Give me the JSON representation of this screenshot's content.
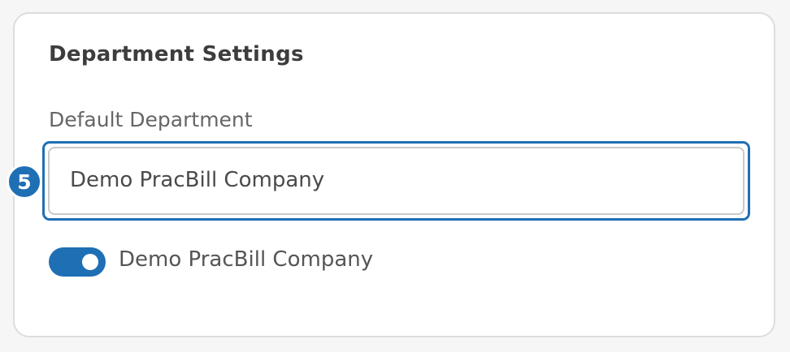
{
  "settings": {
    "title": "Department Settings",
    "default_department": {
      "label": "Default Department",
      "value": "Demo PracBill Company"
    },
    "step_badge": "5",
    "toggle": {
      "label": "Demo PracBill Company",
      "state": "on"
    }
  },
  "colors": {
    "accent": "#1f6fb5",
    "card_border": "#dddddd",
    "page_background": "#f6f6f6"
  }
}
